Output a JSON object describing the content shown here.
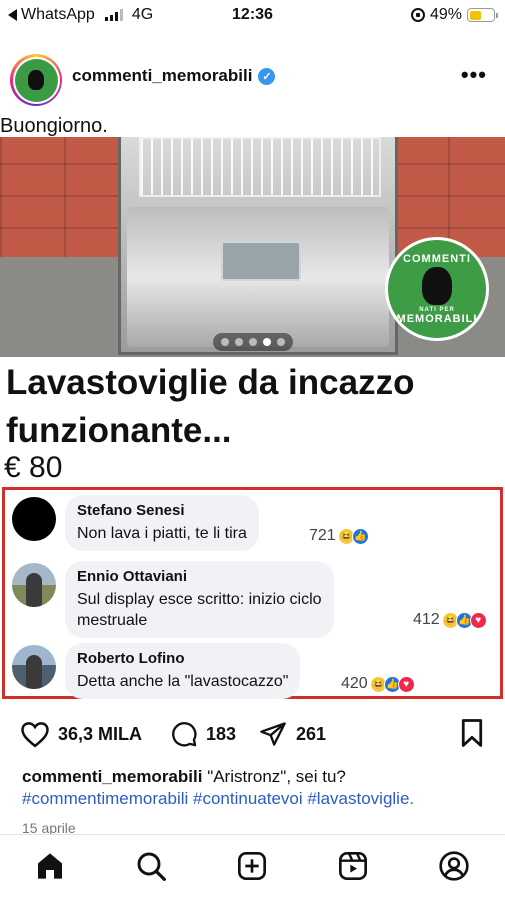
{
  "status_bar": {
    "back_app": "WhatsApp",
    "network": "4G",
    "time": "12:36",
    "battery_percent": "49%",
    "battery_level": 0.49
  },
  "post": {
    "username": "commenti_memorabili",
    "verified": true,
    "more_icon": "more-horizontal-icon",
    "image": {
      "top_caption": "Buongiorno.",
      "badge_text_top": "COMMENTI",
      "badge_text_bottom": "MEMORABILI",
      "badge_small": "NATI PER",
      "headline_line1": "Lavastoviglie da incazzo",
      "headline_line2": "funzionante...",
      "price": "€ 80",
      "carousel": {
        "total": 5,
        "active": 4
      },
      "comments": [
        {
          "name": "Stefano Senesi",
          "text": "Non lava i piatti, te li tira",
          "count": "721"
        },
        {
          "name": "Ennio Ottaviani",
          "text_line1": "Sul display esce scritto: inizio ciclo",
          "text_line2": "mestruale",
          "count": "412"
        },
        {
          "name": "Roberto Lofino",
          "text": "Detta anche la \"lavastocazzo\"",
          "count": "420"
        }
      ]
    },
    "actions": {
      "likes": "36,3 MILA",
      "comments": "183",
      "shares": "261"
    },
    "caption": {
      "username": "commenti_memorabili",
      "text": "\"Aristronz\", sei tu?",
      "hashtags": "#commentimemorabili #continuatevoi #lavastoviglie."
    },
    "date": "15 aprile"
  },
  "colors": {
    "accent_blue": "#3897f0",
    "brand_green": "#3e9b46",
    "highlight_red": "#d0302c",
    "hashtag_blue": "#2c5cc5"
  },
  "bottom_nav": [
    "home-icon",
    "search-icon",
    "create-icon",
    "reels-icon",
    "profile-icon"
  ]
}
